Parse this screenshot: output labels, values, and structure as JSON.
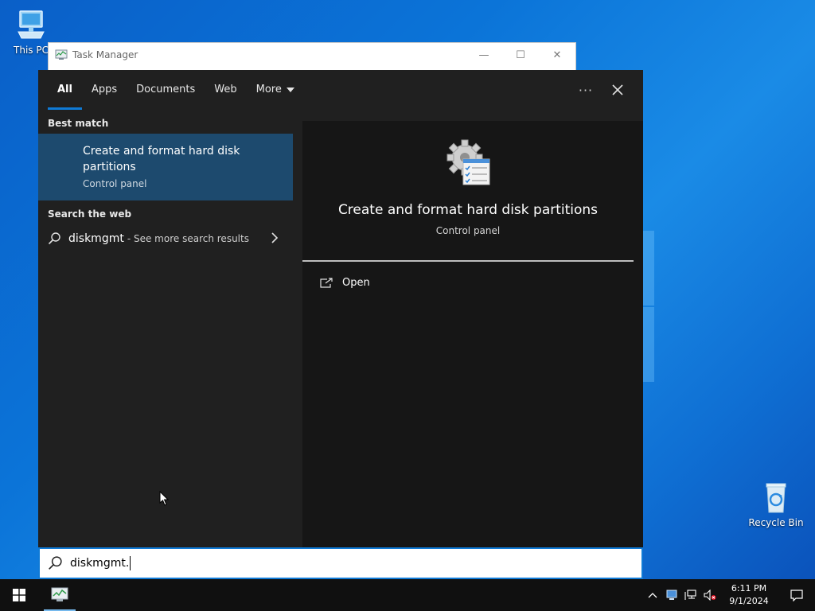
{
  "desktop": {
    "this_pc_label": "This PC",
    "recycle_bin_label": "Recycle Bin"
  },
  "task_manager": {
    "title": "Task Manager",
    "minimize": "—",
    "maximize": "☐",
    "close": "✕"
  },
  "search": {
    "tabs": [
      {
        "label": "All",
        "active": true
      },
      {
        "label": "Apps"
      },
      {
        "label": "Documents"
      },
      {
        "label": "Web"
      },
      {
        "label": "More"
      }
    ],
    "more_options": "···",
    "best_match_heading": "Best match",
    "best_match": {
      "title": "Create and format hard disk partitions",
      "subtitle": "Control panel"
    },
    "web_heading": "Search the web",
    "web_result": {
      "query": "diskmgmt",
      "suffix": "- See more search results"
    },
    "detail": {
      "title": "Create and format hard disk partitions",
      "subtitle": "Control panel",
      "actions": [
        {
          "label": "Open"
        }
      ]
    },
    "query": "diskmgmt."
  },
  "taskbar": {
    "time": "6:11 PM",
    "date": "9/1/2024"
  },
  "colors": {
    "accent": "#0f7ad6",
    "selected": "#1d4a6e",
    "panel": "#202020"
  }
}
